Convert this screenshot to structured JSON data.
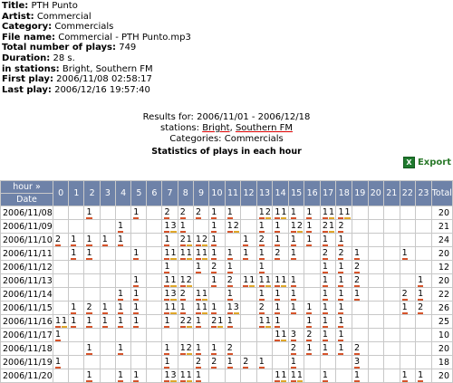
{
  "info": [
    {
      "label": "Title:",
      "value": "PTH Punto"
    },
    {
      "label": "Artist:",
      "value": "Commercial"
    },
    {
      "label": "Category:",
      "value": "Commercials"
    },
    {
      "label": "File name:",
      "value": "Commercial - PTH Punto.mp3"
    },
    {
      "label": "Total number of plays:",
      "value": "749"
    },
    {
      "label": "Duration:",
      "value": "28 s."
    },
    {
      "label": "in stations:",
      "value": "Bright, Southern FM"
    },
    {
      "label": "First play:",
      "value": "2006/11/08 02:58:17"
    },
    {
      "label": "Last play:",
      "value": "2006/12/16 19:57:40"
    }
  ],
  "results": {
    "line1": "Results for: 2006/11/01 - 2006/12/18",
    "stations_prefix": "stations:",
    "station1": "Bright",
    "comma": ",",
    "station2": "Southern FM",
    "categories": "Categories: Commercials",
    "heading": "Statistics of plays in each hour"
  },
  "export_label": "Export",
  "table": {
    "hour_label": "hour »",
    "date_label": "Date",
    "hours": [
      "0",
      "1",
      "2",
      "3",
      "4",
      "5",
      "6",
      "7",
      "8",
      "9",
      "10",
      "11",
      "12",
      "13",
      "14",
      "15",
      "16",
      "17",
      "18",
      "19",
      "20",
      "21",
      "22",
      "23"
    ],
    "total_label": "Total",
    "rows": [
      {
        "date": "2006/11/08",
        "cells": [
          "",
          "",
          "1",
          "",
          "",
          "1",
          "",
          "2",
          "2",
          "2",
          "1",
          "1",
          "",
          "1|2",
          "1|1",
          "1",
          "1",
          "1|1",
          "1|1",
          "",
          "",
          "",
          "",
          ""
        ],
        "total": "20"
      },
      {
        "date": "2006/11/09",
        "cells": [
          "",
          "",
          "",
          "",
          "1",
          "",
          "",
          "1|3",
          "1",
          "",
          "1",
          "1|2",
          "",
          "1",
          "1",
          "1|2",
          "1",
          "2|1",
          "2",
          "",
          "",
          "",
          "",
          ""
        ],
        "total": "21"
      },
      {
        "date": "2006/11/10",
        "cells": [
          "2",
          "1",
          "1",
          "1",
          "1",
          "",
          "",
          "1",
          "2|1",
          "1|2",
          "1",
          "",
          "1",
          "2",
          "1",
          "1",
          "1",
          "1",
          "1",
          "",
          "",
          "",
          "",
          ""
        ],
        "total": "24"
      },
      {
        "date": "2006/11/11",
        "cells": [
          "",
          "1",
          "1",
          "",
          "",
          "1",
          "",
          "1|1",
          "1|1",
          "1|1",
          "1",
          "1",
          "1",
          "1",
          "2",
          "1",
          "",
          "2",
          "2",
          "1",
          "",
          "",
          "1",
          ""
        ],
        "total": "20"
      },
      {
        "date": "2006/11/12",
        "cells": [
          "",
          "",
          "",
          "",
          "",
          "",
          "",
          "1",
          "",
          "1",
          "2",
          "1",
          "",
          "1",
          "",
          "",
          "",
          "1",
          "1",
          "2",
          "",
          "",
          "",
          ""
        ],
        "total": "12"
      },
      {
        "date": "2006/11/13",
        "cells": [
          "",
          "",
          "",
          "",
          "",
          "1",
          "",
          "1|1",
          "1|2",
          "",
          "1",
          "2",
          "1|1",
          "1|1",
          "1|1",
          "1",
          "",
          "1",
          "1",
          "2",
          "",
          "",
          "",
          "1"
        ],
        "total": "20"
      },
      {
        "date": "2006/11/14",
        "cells": [
          "",
          "",
          "",
          "",
          "1",
          "1",
          "",
          "1|3",
          "2",
          "1|1",
          "",
          "1",
          "",
          "1",
          "1",
          "1",
          "",
          "1",
          "1",
          "1",
          "",
          "",
          "2",
          "1"
        ],
        "total": "22"
      },
      {
        "date": "2006/11/15",
        "cells": [
          "",
          "1",
          "2",
          "1",
          "1",
          "1",
          "",
          "1|1",
          "1",
          "1|1",
          "1",
          "1|3",
          "",
          "2",
          "1",
          "1",
          "1",
          "1",
          "1",
          "",
          "",
          "",
          "1",
          "2"
        ],
        "total": "26"
      },
      {
        "date": "2006/11/16",
        "cells": [
          "1|1",
          "1",
          "1",
          "1",
          "1",
          "1",
          "",
          "1",
          "2|2",
          "1",
          "2|1",
          "1",
          "",
          "1|1",
          "1",
          "",
          "1",
          "1",
          "1",
          "",
          "",
          "",
          "",
          ""
        ],
        "total": "25"
      },
      {
        "date": "2006/11/17",
        "cells": [
          "1",
          "",
          "",
          "",
          "",
          "",
          "",
          "",
          "",
          "",
          "",
          "",
          "",
          "",
          "1|1",
          "3",
          "2",
          "1",
          "1",
          "",
          "",
          "",
          "",
          ""
        ],
        "total": "10"
      },
      {
        "date": "2006/11/18",
        "cells": [
          "",
          "",
          "1",
          "",
          "1",
          "",
          "",
          "1",
          "1|2",
          "1",
          "1",
          "2",
          "",
          "",
          "",
          "2",
          "1",
          "1",
          "1",
          "2",
          "",
          "",
          "",
          ""
        ],
        "total": "20"
      },
      {
        "date": "2006/11/19",
        "cells": [
          "1",
          "",
          "",
          "",
          "",
          "",
          "",
          "1",
          "",
          "2",
          "2",
          "1",
          "2",
          "1",
          "",
          "1",
          "",
          "",
          "",
          "3",
          "",
          "",
          "",
          ""
        ],
        "total": "18"
      },
      {
        "date": "2006/11/20",
        "cells": [
          "",
          "",
          "1",
          "",
          "1",
          "1",
          "",
          "1|3",
          "1|1",
          "1",
          "",
          "",
          "",
          "",
          "1|1",
          "1|1",
          "",
          "1",
          "",
          "1",
          "",
          "",
          "1",
          "1"
        ],
        "total": "20"
      }
    ]
  }
}
